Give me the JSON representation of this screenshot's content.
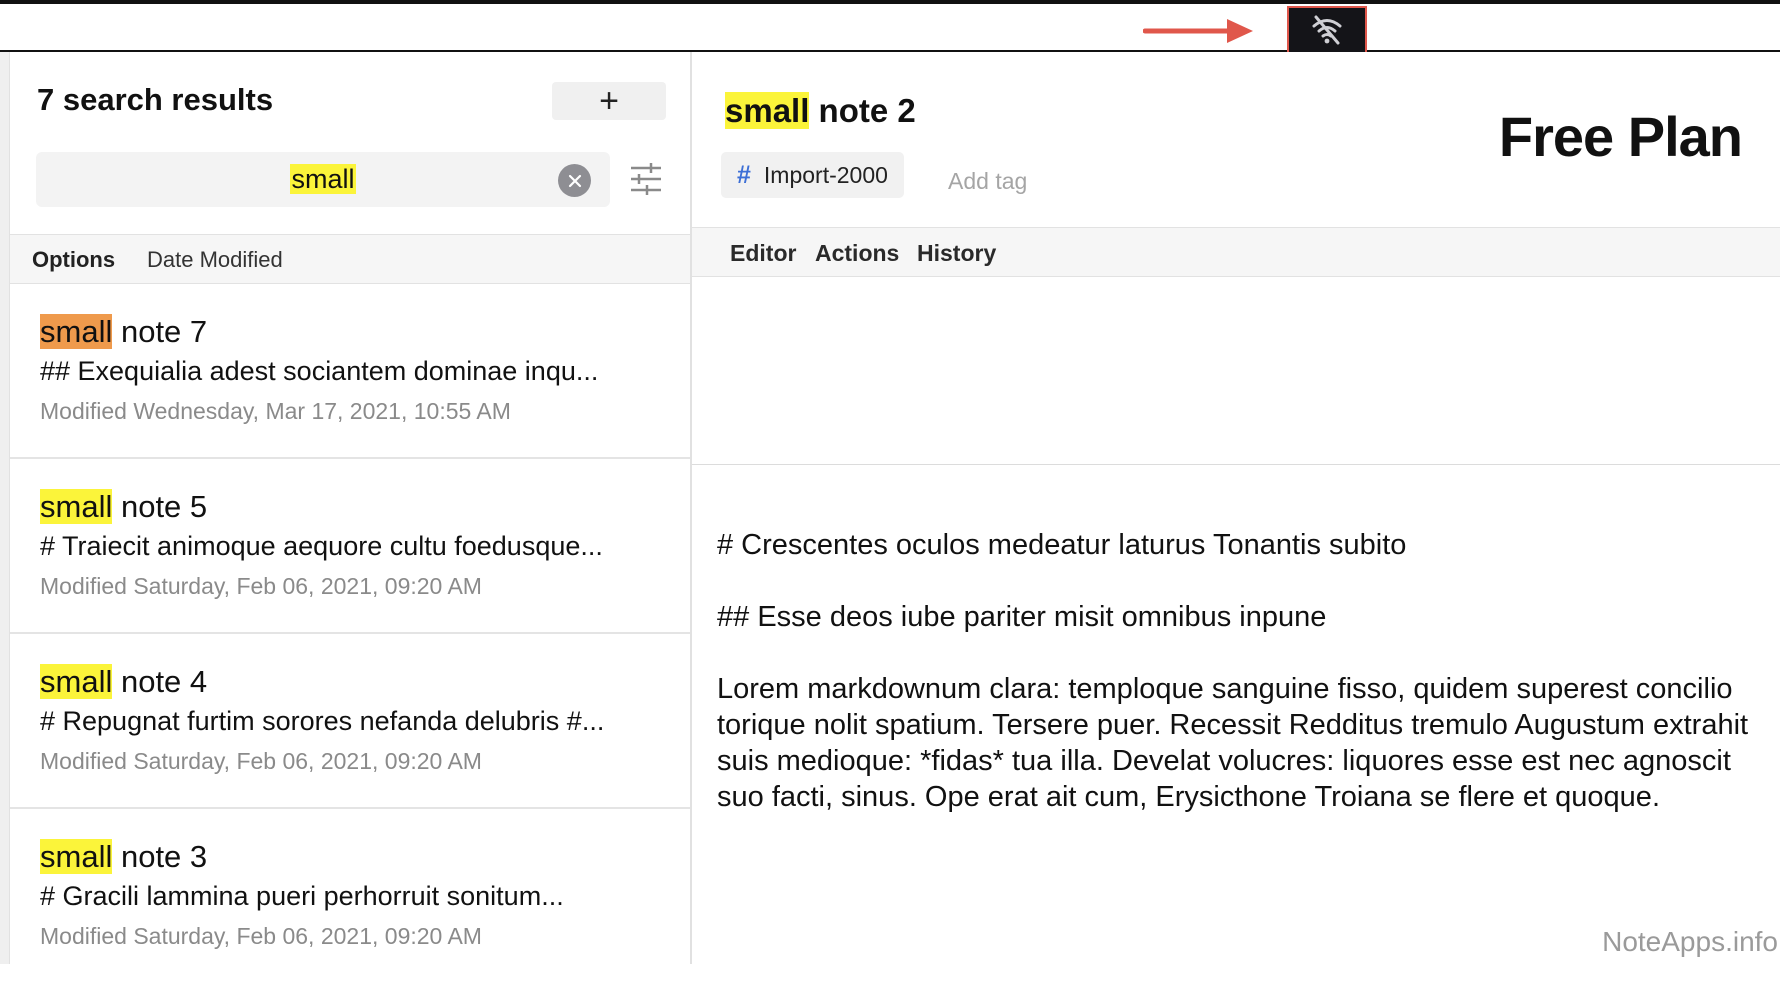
{
  "left": {
    "results_title": "7 search results",
    "add_button": "+",
    "search": {
      "value": "small"
    },
    "sort": {
      "label": "Options",
      "value": "Date Modified"
    },
    "notes": [
      {
        "match": "small",
        "rest": " note 7",
        "preview": "## Exequialia adest sociantem dominae inqu...",
        "date": "Modified Wednesday, Mar 17, 2021, 10:55 AM"
      },
      {
        "match": "small",
        "rest": " note 5",
        "preview": "# Traiecit animoque aequore cultu foedusque...",
        "date": "Modified Saturday, Feb 06, 2021, 09:20 AM"
      },
      {
        "match": "small",
        "rest": " note 4",
        "preview": "# Repugnat furtim sorores nefanda delubris #...",
        "date": "Modified Saturday, Feb 06, 2021, 09:20 AM"
      },
      {
        "match": "small",
        "rest": " note 3",
        "preview": "# Gracili lammina pueri perhorruit sonitum...",
        "date": "Modified Saturday, Feb 06, 2021, 09:20 AM"
      }
    ]
  },
  "editor": {
    "title_match": "small",
    "title_rest": " note 2",
    "tag": "Import-2000",
    "add_tag": "Add tag",
    "plan": "Free Plan",
    "tabs": [
      "Editor",
      "Actions",
      "History"
    ],
    "body": [
      "# Crescentes oculos medeatur laturus Tonantis subito",
      "## Esse deos iube pariter misit omnibus inpune",
      "Lorem markdownum clara: temploque sanguine fisso, quidem superest concilio torique nolit spatium. Tersere puer. Recessit Redditus tremulo Augustum extrahit suis medioque: *fidas* tua illa. Develat volucres: liquores esse est nec agnoscit suo facti, sinus. Ope erat ait cum, Erysicthone Troiana se flere et quoque."
    ]
  },
  "watermark": "NoteApps.info",
  "icons": {
    "offline": "wifi-off-icon",
    "clear": "clear-icon",
    "filter": "filter-icon",
    "arrow": "annotation-arrow"
  },
  "colors": {
    "highlight": "#fbf43a",
    "highlight_current": "#ef9a4c",
    "tag_hash": "#3d6fd6",
    "arrow": "#e0574b"
  }
}
